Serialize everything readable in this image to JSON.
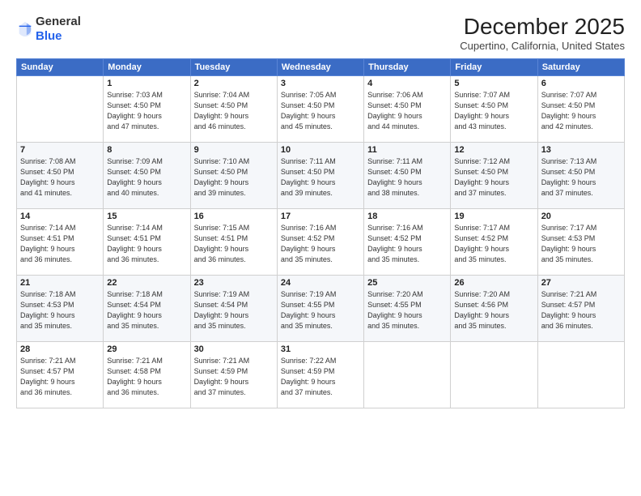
{
  "header": {
    "logo_line1": "General",
    "logo_line2": "Blue",
    "month": "December 2025",
    "location": "Cupertino, California, United States"
  },
  "weekdays": [
    "Sunday",
    "Monday",
    "Tuesday",
    "Wednesday",
    "Thursday",
    "Friday",
    "Saturday"
  ],
  "weeks": [
    [
      {
        "day": "",
        "info": ""
      },
      {
        "day": "1",
        "info": "Sunrise: 7:03 AM\nSunset: 4:50 PM\nDaylight: 9 hours\nand 47 minutes."
      },
      {
        "day": "2",
        "info": "Sunrise: 7:04 AM\nSunset: 4:50 PM\nDaylight: 9 hours\nand 46 minutes."
      },
      {
        "day": "3",
        "info": "Sunrise: 7:05 AM\nSunset: 4:50 PM\nDaylight: 9 hours\nand 45 minutes."
      },
      {
        "day": "4",
        "info": "Sunrise: 7:06 AM\nSunset: 4:50 PM\nDaylight: 9 hours\nand 44 minutes."
      },
      {
        "day": "5",
        "info": "Sunrise: 7:07 AM\nSunset: 4:50 PM\nDaylight: 9 hours\nand 43 minutes."
      },
      {
        "day": "6",
        "info": "Sunrise: 7:07 AM\nSunset: 4:50 PM\nDaylight: 9 hours\nand 42 minutes."
      }
    ],
    [
      {
        "day": "7",
        "info": "Sunrise: 7:08 AM\nSunset: 4:50 PM\nDaylight: 9 hours\nand 41 minutes."
      },
      {
        "day": "8",
        "info": "Sunrise: 7:09 AM\nSunset: 4:50 PM\nDaylight: 9 hours\nand 40 minutes."
      },
      {
        "day": "9",
        "info": "Sunrise: 7:10 AM\nSunset: 4:50 PM\nDaylight: 9 hours\nand 39 minutes."
      },
      {
        "day": "10",
        "info": "Sunrise: 7:11 AM\nSunset: 4:50 PM\nDaylight: 9 hours\nand 39 minutes."
      },
      {
        "day": "11",
        "info": "Sunrise: 7:11 AM\nSunset: 4:50 PM\nDaylight: 9 hours\nand 38 minutes."
      },
      {
        "day": "12",
        "info": "Sunrise: 7:12 AM\nSunset: 4:50 PM\nDaylight: 9 hours\nand 37 minutes."
      },
      {
        "day": "13",
        "info": "Sunrise: 7:13 AM\nSunset: 4:50 PM\nDaylight: 9 hours\nand 37 minutes."
      }
    ],
    [
      {
        "day": "14",
        "info": "Sunrise: 7:14 AM\nSunset: 4:51 PM\nDaylight: 9 hours\nand 36 minutes."
      },
      {
        "day": "15",
        "info": "Sunrise: 7:14 AM\nSunset: 4:51 PM\nDaylight: 9 hours\nand 36 minutes."
      },
      {
        "day": "16",
        "info": "Sunrise: 7:15 AM\nSunset: 4:51 PM\nDaylight: 9 hours\nand 36 minutes."
      },
      {
        "day": "17",
        "info": "Sunrise: 7:16 AM\nSunset: 4:52 PM\nDaylight: 9 hours\nand 35 minutes."
      },
      {
        "day": "18",
        "info": "Sunrise: 7:16 AM\nSunset: 4:52 PM\nDaylight: 9 hours\nand 35 minutes."
      },
      {
        "day": "19",
        "info": "Sunrise: 7:17 AM\nSunset: 4:52 PM\nDaylight: 9 hours\nand 35 minutes."
      },
      {
        "day": "20",
        "info": "Sunrise: 7:17 AM\nSunset: 4:53 PM\nDaylight: 9 hours\nand 35 minutes."
      }
    ],
    [
      {
        "day": "21",
        "info": "Sunrise: 7:18 AM\nSunset: 4:53 PM\nDaylight: 9 hours\nand 35 minutes."
      },
      {
        "day": "22",
        "info": "Sunrise: 7:18 AM\nSunset: 4:54 PM\nDaylight: 9 hours\nand 35 minutes."
      },
      {
        "day": "23",
        "info": "Sunrise: 7:19 AM\nSunset: 4:54 PM\nDaylight: 9 hours\nand 35 minutes."
      },
      {
        "day": "24",
        "info": "Sunrise: 7:19 AM\nSunset: 4:55 PM\nDaylight: 9 hours\nand 35 minutes."
      },
      {
        "day": "25",
        "info": "Sunrise: 7:20 AM\nSunset: 4:55 PM\nDaylight: 9 hours\nand 35 minutes."
      },
      {
        "day": "26",
        "info": "Sunrise: 7:20 AM\nSunset: 4:56 PM\nDaylight: 9 hours\nand 35 minutes."
      },
      {
        "day": "27",
        "info": "Sunrise: 7:21 AM\nSunset: 4:57 PM\nDaylight: 9 hours\nand 36 minutes."
      }
    ],
    [
      {
        "day": "28",
        "info": "Sunrise: 7:21 AM\nSunset: 4:57 PM\nDaylight: 9 hours\nand 36 minutes."
      },
      {
        "day": "29",
        "info": "Sunrise: 7:21 AM\nSunset: 4:58 PM\nDaylight: 9 hours\nand 36 minutes."
      },
      {
        "day": "30",
        "info": "Sunrise: 7:21 AM\nSunset: 4:59 PM\nDaylight: 9 hours\nand 37 minutes."
      },
      {
        "day": "31",
        "info": "Sunrise: 7:22 AM\nSunset: 4:59 PM\nDaylight: 9 hours\nand 37 minutes."
      },
      {
        "day": "",
        "info": ""
      },
      {
        "day": "",
        "info": ""
      },
      {
        "day": "",
        "info": ""
      }
    ]
  ]
}
